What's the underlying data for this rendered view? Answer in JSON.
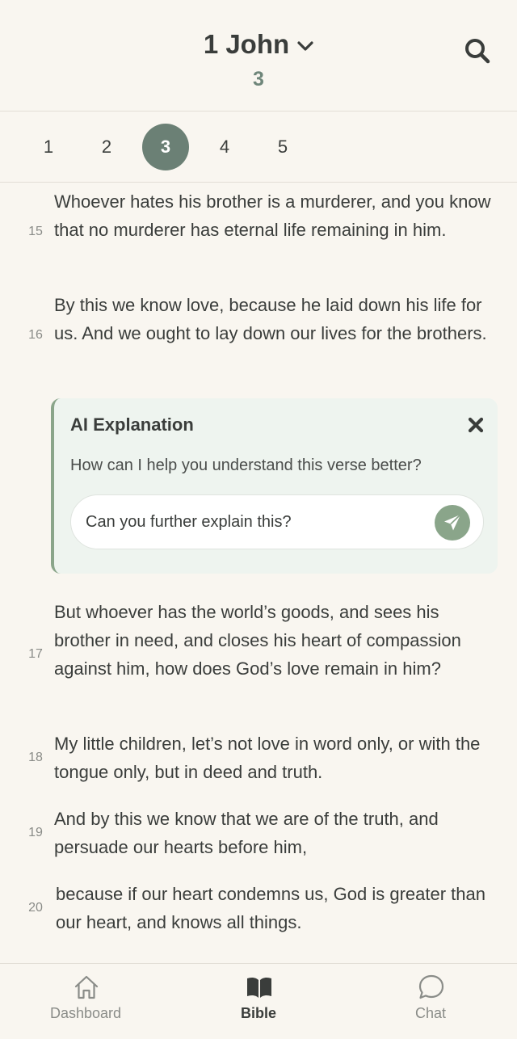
{
  "header": {
    "book": "1 John",
    "chapter": "3"
  },
  "chapters": [
    "1",
    "2",
    "3",
    "4",
    "5"
  ],
  "active_chapter": "3",
  "verses": [
    {
      "num": "15",
      "text": "Whoever hates his brother is a murderer, and you know that no murderer has eternal life remaining in him."
    },
    {
      "num": "16",
      "text": "By this we know love, because he laid down his life for us. And we ought to lay down our lives for the brothers."
    },
    {
      "num": "17",
      "text": "But whoever has the world’s goods, and sees his brother in need, and closes his heart of compassion against him, how does God’s love remain in him?"
    },
    {
      "num": "18",
      "text": "My little children, let’s not love in word only, or with the tongue only, but in deed and truth."
    },
    {
      "num": "19",
      "text": "And by this we know that we are of the truth, and persuade our hearts before him,"
    },
    {
      "num": "20",
      "text": "because if our heart condemns us, God is greater than our heart, and knows all things."
    }
  ],
  "ai_panel": {
    "title": "AI Explanation",
    "prompt": "How can I help you understand this verse better?",
    "input_value": "Can you further explain this?"
  },
  "nav": [
    {
      "label": "Dashboard",
      "icon": "home-icon"
    },
    {
      "label": "Bible",
      "icon": "book-icon"
    },
    {
      "label": "Chat",
      "icon": "chat-bubble-icon"
    }
  ],
  "colors": {
    "accent": "#6b8075",
    "ai_accent": "#8aa58a",
    "background": "#f9f6f0",
    "ai_panel_bg": "#eef4ef"
  }
}
